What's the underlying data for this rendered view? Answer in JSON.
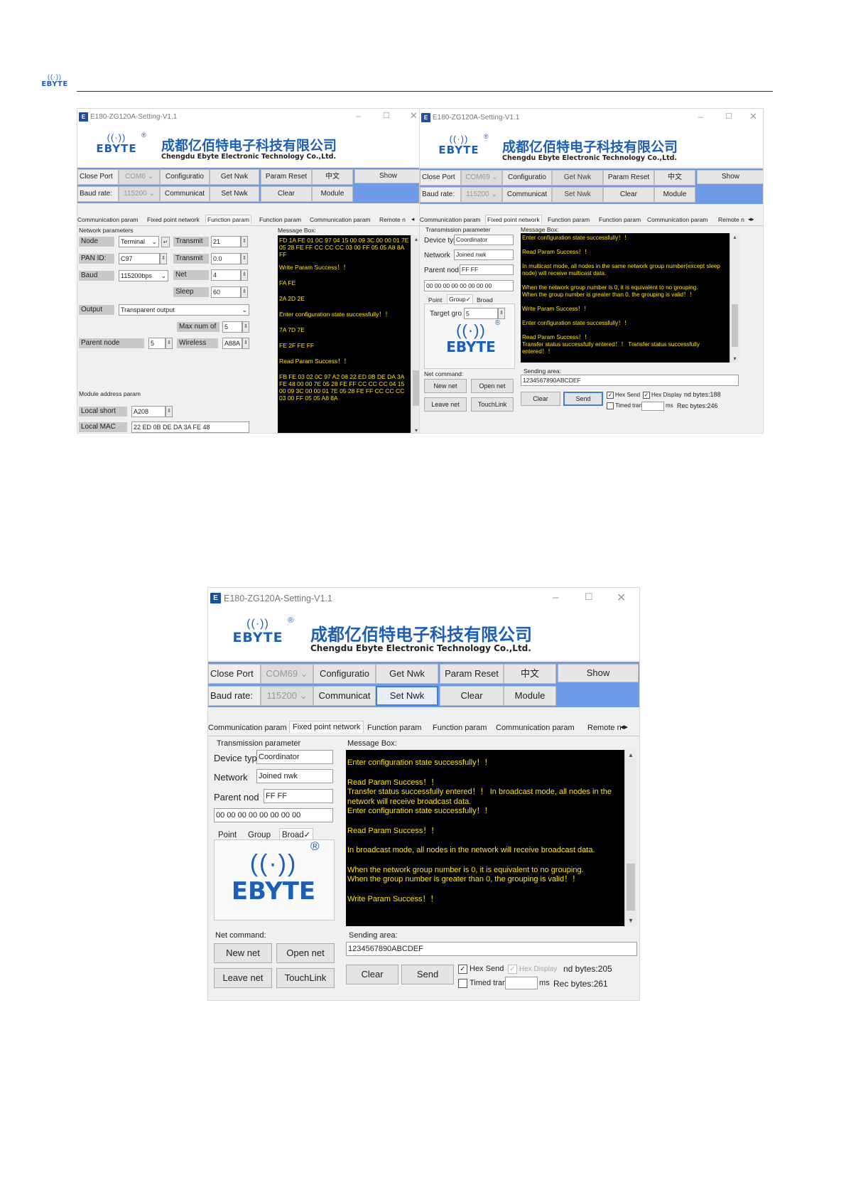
{
  "page": {
    "logo_word": "EBYTE"
  },
  "app": {
    "window_title": "E180-ZG120A-Setting-V1.1",
    "company_cn": "成都亿佰特电子科技有限公司",
    "company_en": "Chengdu Ebyte Electronic Technology Co.,Ltd.",
    "logo_word": "EBYTE",
    "registered": "®",
    "close_port": "Close Port",
    "baud_rate_label": "Baud rate:",
    "configuration": "Configuratio",
    "communication": "Communicat",
    "get_nwk": "Get Nwk",
    "set_nwk": "Set Nwk",
    "param_reset": "Param Reset",
    "clear": "Clear",
    "chinese": "中文",
    "module": "Module",
    "show": "Show",
    "tab_communication_param": "Communication param",
    "tab_fixed_point_network": "Fixed point network",
    "tab_function_param": "Function param",
    "tab_remote": "Remote n",
    "message_box_label": "Message Box:"
  },
  "win1": {
    "com_port": "COM6",
    "baud_value": "115200",
    "network_parameters": "Network parameters",
    "node_label": "Node",
    "node_value": "Terminal",
    "pan_id_label": "PAN  ID:",
    "pan_id_value": "C97",
    "baud_label": "Baud",
    "baud_field": "115200bps",
    "transmit_label_1": "Transmit",
    "transmit_value_1": "21",
    "transmit_label_2": "Transmit",
    "transmit_value_2": "0.0",
    "net_label": "Net",
    "net_value": "4",
    "sleep_label": "Sleep",
    "sleep_value": "60",
    "output_label": "Output",
    "output_value": "Transparent output",
    "max_num_label": "Max num of",
    "max_num_value": "5",
    "parent_node_label": "Parent node",
    "parent_node_value": "5",
    "wireless_label": "Wireless",
    "wireless_value": "A88A",
    "module_address_param": "Module address param",
    "local_short_label": "Local short",
    "local_short_value": "A208",
    "local_mac_label": "Local MAC",
    "local_mac_value": "22 ED 0B DE DA 3A FE 48",
    "messages": [
      "FD 1A FE 01 0C 97 04 15 00 09 3C 00 00 01 7E 05 28 FE FF CC CC CC 03 00 FF 05 05 A8 8A FF",
      "Write Param Success！！",
      "FA FE",
      "2A 2D 2E",
      "Enter configuration state successfully！！",
      "7A 7D 7E",
      "FE 2F FE FF",
      "Read Param Success！！",
      "FB FE 03 02 0C 97 A2 08 22 ED 0B DE DA 3A FE 48 00 00 7E 05 28 FE FF CC CC CC 04 15 00 09 3C 00 00 01 7E 05 28 FE FF CC CC CC 03 00 FF 05 05 A8 8A"
    ]
  },
  "win2": {
    "com_port": "COM69",
    "baud_value": "115200",
    "transmission_parameter": "Transmission parameter",
    "device_type_label": "Device typ",
    "device_type_value": "Coordinator",
    "network_label": "Network",
    "network_value": "Joined nwk",
    "parent_node_label": "Parent nod",
    "parent_node_value": "FF FF",
    "address_value": "00 00 00 00 00 00 00 00",
    "tab_point": "Point",
    "tab_group": "Group✓",
    "tab_broad": "Broad",
    "target_group_label": "Target gro",
    "target_group_value": "5",
    "net_command": "Net command:",
    "new_net": "New net",
    "open_net": "Open net",
    "leave_net": "Leave net",
    "touchlink": "TouchLink",
    "messages": [
      "Enter configuration state successfully！！",
      "Read Param Success！！",
      "In multicast mode, all nodes in the same network group number(except sleep node) will receive multicast data.",
      "When the network group number is 0, it is equivalent to no grouping.",
      "When the group number is greater than 0, the grouping is valid！！",
      "Write Param Success！！",
      "Enter configuration state successfully！！",
      "Read Param Success！！",
      "Transfer status successfully entered！！ Transfer status successfully entered！！"
    ],
    "sending_area": "Sending area:",
    "send_value": "1234567890ABCDEF",
    "clear": "Clear",
    "send": "Send",
    "hex_send": "Hex Send",
    "hex_display": "Hex Display",
    "send_bytes": "nd bytes:188",
    "timed_tran": "Timed tran",
    "ms": "ms",
    "rec_bytes": "Rec bytes:246"
  },
  "win3": {
    "com_port": "COM69",
    "baud_value": "115200",
    "transmission_parameter": "Transmission parameter",
    "device_type_label": "Device typ",
    "device_type_value": "Coordinator",
    "network_label": "Network",
    "network_value": "Joined nwk",
    "parent_node_label": "Parent nod",
    "parent_node_value": "FF FF",
    "address_value": "00 00 00 00 00 00 00 00",
    "tab_point": "Point",
    "tab_group": "Group",
    "tab_broad": "Broad✓",
    "net_command": "Net command:",
    "new_net": "New net",
    "open_net": "Open net",
    "leave_net": "Leave net",
    "touchlink": "TouchLink",
    "messages": [
      "Enter configuration state successfully！！",
      "Read Param Success！！",
      "Transfer status successfully entered！！ In broadcast mode, all nodes in the network will receive broadcast data.",
      "Enter configuration state successfully！！",
      "Read Param Success！！",
      "In broadcast mode, all nodes in the network will receive broadcast data.",
      "When the network group number is 0, it is equivalent to no grouping.",
      "When the group number is greater than 0, the grouping is valid！！",
      "Write Param Success！！"
    ],
    "sending_area": "Sending area:",
    "send_value": "1234567890ABCDEF",
    "clear": "Clear",
    "send": "Send",
    "hex_send": "Hex Send",
    "hex_display": "Hex Display",
    "send_bytes": "nd bytes:205",
    "timed_tran": "Timed tran",
    "ms": "ms",
    "rec_bytes": "Rec bytes:261"
  },
  "colors": {
    "brand_blue": "#1d5fb8",
    "toolbar_blue": "#6f9ae8",
    "message_bg": "#000000",
    "message_text": "#ffe600"
  },
  "icons": [
    "ebyte-wireless-logo",
    "app-icon",
    "minimize-icon",
    "maximize-icon",
    "close-icon",
    "spin-icon",
    "dropdown-icon"
  ]
}
